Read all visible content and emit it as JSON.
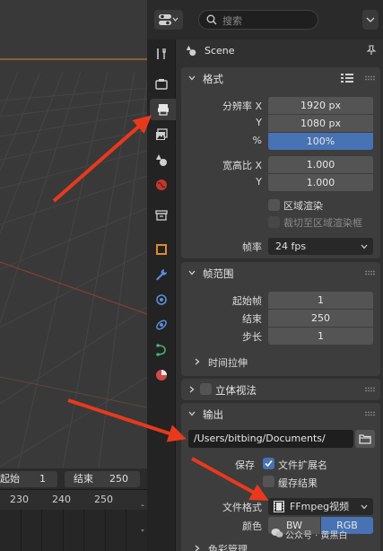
{
  "header": {
    "search_placeholder": "搜索"
  },
  "context": {
    "scene_label": "Scene"
  },
  "format_panel": {
    "title": "格式",
    "resolution_x_label": "分辨率 X",
    "resolution_x": "1920 px",
    "resolution_y_label": "Y",
    "resolution_y": "1080 px",
    "percent_label": "%",
    "percent": "100%",
    "aspect_x_label": "宽高比 X",
    "aspect_x": "1.000",
    "aspect_y_label": "Y",
    "aspect_y": "1.000",
    "region_render_label": "区域渲染",
    "crop_label": "裁切至区域渲染框",
    "framerate_label": "帧率",
    "framerate": "24 fps"
  },
  "frame_range_panel": {
    "title": "帧范围",
    "start_label": "起始帧",
    "start": "1",
    "end_label": "结束",
    "end": "250",
    "step_label": "步长",
    "step": "1",
    "time_stretch_label": "时间拉伸"
  },
  "stereoscopy_panel": {
    "title": "立体视法"
  },
  "output_panel": {
    "title": "输出",
    "path": "/Users/bitbing/Documents/",
    "save_label": "保存",
    "file_ext_label": "文件扩展名",
    "cache_result_label": "缓存结果",
    "file_format_label": "文件格式",
    "file_format": "FFmpeg视频",
    "color_label": "颜色",
    "color_bw": "BW",
    "color_rgb": "RGB",
    "color_mgmt_label": "色彩管理"
  },
  "timeline": {
    "start_label": "起始",
    "start_value": "1",
    "end_label": "结束",
    "end_value": "250",
    "ticks": [
      "230",
      "240",
      "250"
    ]
  },
  "watermark": "公众号 · 黄黑白",
  "colors": {
    "accent": "#4772b3",
    "arrow": "#e8391d",
    "panel_bg": "#3d3d3d",
    "field_bg": "#545454"
  }
}
